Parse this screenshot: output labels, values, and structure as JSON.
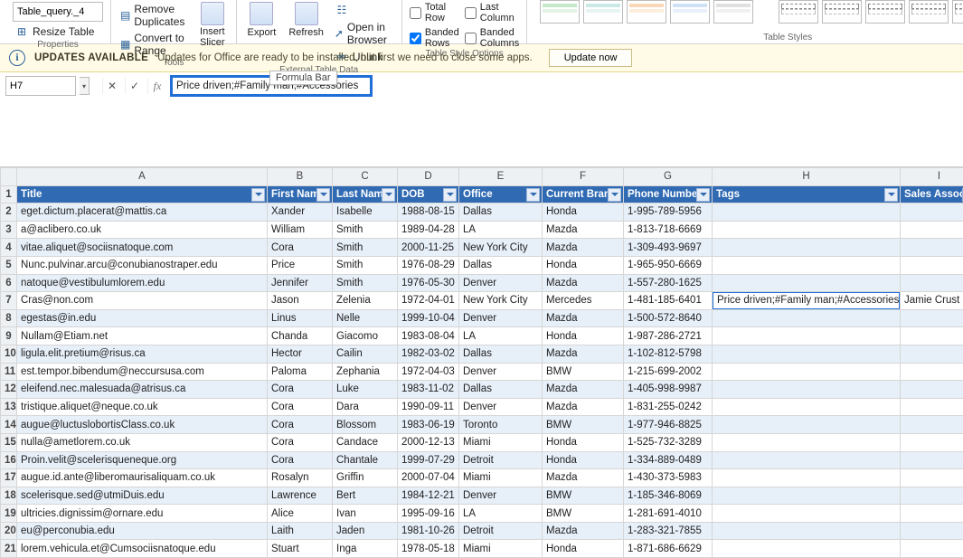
{
  "ribbon": {
    "properties": {
      "table_name": "Table_query._4",
      "resize": "Resize Table",
      "label": "Properties"
    },
    "tools": {
      "remove_dup": "Remove Duplicates",
      "convert_range": "Convert to Range",
      "insert_slicer": "Insert\nSlicer",
      "label": "Tools"
    },
    "external": {
      "export": "Export",
      "refresh": "Refresh",
      "open_browser": "Open in Browser",
      "unlink": "Unlink",
      "label": "External Table Data"
    },
    "options": {
      "total_row": "Total Row",
      "banded_rows": "Banded Rows",
      "last_col": "Last Column",
      "banded_cols": "Banded Columns",
      "label": "Table Style Options"
    },
    "styles_label": "Table Styles"
  },
  "msgbar": {
    "title": "UPDATES AVAILABLE",
    "text": "Updates for Office are ready to be installed, but first we need to close some apps.",
    "button": "Update now"
  },
  "formula": {
    "name_box": "H7",
    "value": "Price driven;#Family man;#Accessories",
    "tooltip": "Formula Bar"
  },
  "columns_letters": [
    "A",
    "B",
    "C",
    "D",
    "E",
    "F",
    "G",
    "H",
    "I"
  ],
  "headers": [
    "Title",
    "First Name",
    "Last Name",
    "DOB",
    "Office",
    "Current Brand",
    "Phone Number",
    "Tags",
    "Sales Associate"
  ],
  "active": {
    "row": 7,
    "col": 8,
    "text": "Price driven;#Family man;#Accessories",
    "assoc": "Jamie Crust"
  },
  "rows": [
    {
      "n": 2,
      "c": [
        "eget.dictum.placerat@mattis.ca",
        "Xander",
        "Isabelle",
        "1988-08-15",
        "Dallas",
        "Honda",
        "1-995-789-5956",
        "",
        ""
      ]
    },
    {
      "n": 3,
      "c": [
        "a@aclibero.co.uk",
        "William",
        "Smith",
        "1989-04-28",
        "LA",
        "Mazda",
        "1-813-718-6669",
        "",
        ""
      ]
    },
    {
      "n": 4,
      "c": [
        "vitae.aliquet@sociisnatoque.com",
        "Cora",
        "Smith",
        "2000-11-25",
        "New York City",
        "Mazda",
        "1-309-493-9697",
        "",
        ""
      ]
    },
    {
      "n": 5,
      "c": [
        "Nunc.pulvinar.arcu@conubianostraper.edu",
        "Price",
        "Smith",
        "1976-08-29",
        "Dallas",
        "Honda",
        "1-965-950-6669",
        "",
        ""
      ]
    },
    {
      "n": 6,
      "c": [
        "natoque@vestibulumlorem.edu",
        "Jennifer",
        "Smith",
        "1976-05-30",
        "Denver",
        "Mazda",
        "1-557-280-1625",
        "",
        ""
      ]
    },
    {
      "n": 7,
      "c": [
        "Cras@non.com",
        "Jason",
        "Zelenia",
        "1972-04-01",
        "New York City",
        "Mercedes",
        "1-481-185-6401",
        "Price driven;#Family man;#Accessories",
        "Jamie Crust"
      ]
    },
    {
      "n": 8,
      "c": [
        "egestas@in.edu",
        "Linus",
        "Nelle",
        "1999-10-04",
        "Denver",
        "Mazda",
        "1-500-572-8640",
        "",
        ""
      ]
    },
    {
      "n": 9,
      "c": [
        "Nullam@Etiam.net",
        "Chanda",
        "Giacomo",
        "1983-08-04",
        "LA",
        "Honda",
        "1-987-286-2721",
        "",
        ""
      ]
    },
    {
      "n": 10,
      "c": [
        "ligula.elit.pretium@risus.ca",
        "Hector",
        "Cailin",
        "1982-03-02",
        "Dallas",
        "Mazda",
        "1-102-812-5798",
        "",
        ""
      ]
    },
    {
      "n": 11,
      "c": [
        "est.tempor.bibendum@neccursusa.com",
        "Paloma",
        "Zephania",
        "1972-04-03",
        "Denver",
        "BMW",
        "1-215-699-2002",
        "",
        ""
      ]
    },
    {
      "n": 12,
      "c": [
        "eleifend.nec.malesuada@atrisus.ca",
        "Cora",
        "Luke",
        "1983-11-02",
        "Dallas",
        "Mazda",
        "1-405-998-9987",
        "",
        ""
      ]
    },
    {
      "n": 13,
      "c": [
        "tristique.aliquet@neque.co.uk",
        "Cora",
        "Dara",
        "1990-09-11",
        "Denver",
        "Mazda",
        "1-831-255-0242",
        "",
        ""
      ]
    },
    {
      "n": 14,
      "c": [
        "augue@luctuslobortisClass.co.uk",
        "Cora",
        "Blossom",
        "1983-06-19",
        "Toronto",
        "BMW",
        "1-977-946-8825",
        "",
        ""
      ]
    },
    {
      "n": 15,
      "c": [
        "nulla@ametlorem.co.uk",
        "Cora",
        "Candace",
        "2000-12-13",
        "Miami",
        "Honda",
        "1-525-732-3289",
        "",
        ""
      ]
    },
    {
      "n": 16,
      "c": [
        "Proin.velit@scelerisqueneque.org",
        "Cora",
        "Chantale",
        "1999-07-29",
        "Detroit",
        "Honda",
        "1-334-889-0489",
        "",
        ""
      ]
    },
    {
      "n": 17,
      "c": [
        "augue.id.ante@liberomaurisaliquam.co.uk",
        "Rosalyn",
        "Griffin",
        "2000-07-04",
        "Miami",
        "Mazda",
        "1-430-373-5983",
        "",
        ""
      ]
    },
    {
      "n": 18,
      "c": [
        "scelerisque.sed@utmiDuis.edu",
        "Lawrence",
        "Bert",
        "1984-12-21",
        "Denver",
        "BMW",
        "1-185-346-8069",
        "",
        ""
      ]
    },
    {
      "n": 19,
      "c": [
        "ultricies.dignissim@ornare.edu",
        "Alice",
        "Ivan",
        "1995-09-16",
        "LA",
        "BMW",
        "1-281-691-4010",
        "",
        ""
      ]
    },
    {
      "n": 20,
      "c": [
        "eu@perconubia.edu",
        "Laith",
        "Jaden",
        "1981-10-26",
        "Detroit",
        "Mazda",
        "1-283-321-7855",
        "",
        ""
      ]
    },
    {
      "n": 21,
      "c": [
        "lorem.vehicula.et@Cumsociisnatoque.edu",
        "Stuart",
        "Inga",
        "1978-05-18",
        "Miami",
        "Honda",
        "1-871-686-6629",
        "",
        ""
      ]
    }
  ]
}
